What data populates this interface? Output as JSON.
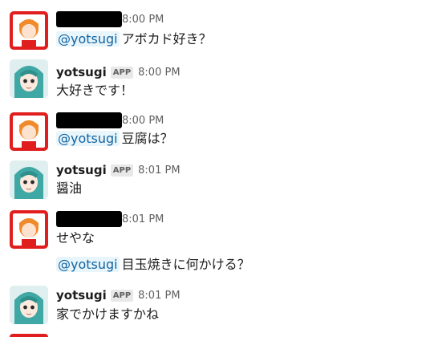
{
  "messages": [
    {
      "author": "",
      "redacted": true,
      "time": "8:00 PM",
      "mention": "@yotsugi",
      "text": "アボカド好き？"
    },
    {
      "author": "yotsugi",
      "badge": "APP",
      "time": "8:00 PM",
      "text": "大好きです！"
    },
    {
      "author": "",
      "redacted": true,
      "time": "8:00 PM",
      "mention": "@yotsugi",
      "text": "豆腐は？"
    },
    {
      "author": "yotsugi",
      "badge": "APP",
      "time": "8:01 PM",
      "text": "醤油"
    },
    {
      "author": "",
      "redacted": true,
      "time": "8:01 PM",
      "text": "せやな",
      "followup_mention": "@yotsugi",
      "followup_text": "目玉焼きに何かける？"
    },
    {
      "author": "yotsugi",
      "badge": "APP",
      "time": "8:01 PM",
      "text": "家でかけますかね"
    }
  ],
  "colors": {
    "mention_text": "#1264a3",
    "mention_bg": "#e8f5fa",
    "user_avatar_bg": "#e01e1e",
    "bot_avatar_bg": "#3fa7a4"
  },
  "icons": {
    "user_avatar": "orange-character-avatar-icon",
    "bot_avatar": "teal-hair-character-avatar-icon"
  }
}
